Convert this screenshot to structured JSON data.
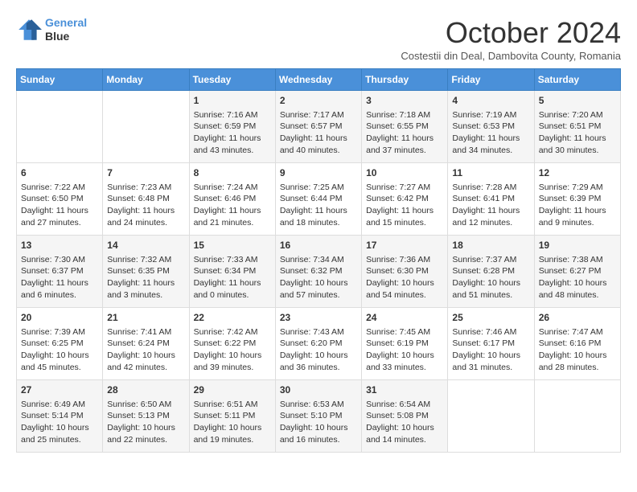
{
  "header": {
    "logo_line1": "General",
    "logo_line2": "Blue",
    "month": "October 2024",
    "location": "Costestii din Deal, Dambovita County, Romania"
  },
  "days_of_week": [
    "Sunday",
    "Monday",
    "Tuesday",
    "Wednesday",
    "Thursday",
    "Friday",
    "Saturday"
  ],
  "weeks": [
    [
      {
        "day": "",
        "content": ""
      },
      {
        "day": "",
        "content": ""
      },
      {
        "day": "1",
        "content": "Sunrise: 7:16 AM\nSunset: 6:59 PM\nDaylight: 11 hours and 43 minutes."
      },
      {
        "day": "2",
        "content": "Sunrise: 7:17 AM\nSunset: 6:57 PM\nDaylight: 11 hours and 40 minutes."
      },
      {
        "day": "3",
        "content": "Sunrise: 7:18 AM\nSunset: 6:55 PM\nDaylight: 11 hours and 37 minutes."
      },
      {
        "day": "4",
        "content": "Sunrise: 7:19 AM\nSunset: 6:53 PM\nDaylight: 11 hours and 34 minutes."
      },
      {
        "day": "5",
        "content": "Sunrise: 7:20 AM\nSunset: 6:51 PM\nDaylight: 11 hours and 30 minutes."
      }
    ],
    [
      {
        "day": "6",
        "content": "Sunrise: 7:22 AM\nSunset: 6:50 PM\nDaylight: 11 hours and 27 minutes."
      },
      {
        "day": "7",
        "content": "Sunrise: 7:23 AM\nSunset: 6:48 PM\nDaylight: 11 hours and 24 minutes."
      },
      {
        "day": "8",
        "content": "Sunrise: 7:24 AM\nSunset: 6:46 PM\nDaylight: 11 hours and 21 minutes."
      },
      {
        "day": "9",
        "content": "Sunrise: 7:25 AM\nSunset: 6:44 PM\nDaylight: 11 hours and 18 minutes."
      },
      {
        "day": "10",
        "content": "Sunrise: 7:27 AM\nSunset: 6:42 PM\nDaylight: 11 hours and 15 minutes."
      },
      {
        "day": "11",
        "content": "Sunrise: 7:28 AM\nSunset: 6:41 PM\nDaylight: 11 hours and 12 minutes."
      },
      {
        "day": "12",
        "content": "Sunrise: 7:29 AM\nSunset: 6:39 PM\nDaylight: 11 hours and 9 minutes."
      }
    ],
    [
      {
        "day": "13",
        "content": "Sunrise: 7:30 AM\nSunset: 6:37 PM\nDaylight: 11 hours and 6 minutes."
      },
      {
        "day": "14",
        "content": "Sunrise: 7:32 AM\nSunset: 6:35 PM\nDaylight: 11 hours and 3 minutes."
      },
      {
        "day": "15",
        "content": "Sunrise: 7:33 AM\nSunset: 6:34 PM\nDaylight: 11 hours and 0 minutes."
      },
      {
        "day": "16",
        "content": "Sunrise: 7:34 AM\nSunset: 6:32 PM\nDaylight: 10 hours and 57 minutes."
      },
      {
        "day": "17",
        "content": "Sunrise: 7:36 AM\nSunset: 6:30 PM\nDaylight: 10 hours and 54 minutes."
      },
      {
        "day": "18",
        "content": "Sunrise: 7:37 AM\nSunset: 6:28 PM\nDaylight: 10 hours and 51 minutes."
      },
      {
        "day": "19",
        "content": "Sunrise: 7:38 AM\nSunset: 6:27 PM\nDaylight: 10 hours and 48 minutes."
      }
    ],
    [
      {
        "day": "20",
        "content": "Sunrise: 7:39 AM\nSunset: 6:25 PM\nDaylight: 10 hours and 45 minutes."
      },
      {
        "day": "21",
        "content": "Sunrise: 7:41 AM\nSunset: 6:24 PM\nDaylight: 10 hours and 42 minutes."
      },
      {
        "day": "22",
        "content": "Sunrise: 7:42 AM\nSunset: 6:22 PM\nDaylight: 10 hours and 39 minutes."
      },
      {
        "day": "23",
        "content": "Sunrise: 7:43 AM\nSunset: 6:20 PM\nDaylight: 10 hours and 36 minutes."
      },
      {
        "day": "24",
        "content": "Sunrise: 7:45 AM\nSunset: 6:19 PM\nDaylight: 10 hours and 33 minutes."
      },
      {
        "day": "25",
        "content": "Sunrise: 7:46 AM\nSunset: 6:17 PM\nDaylight: 10 hours and 31 minutes."
      },
      {
        "day": "26",
        "content": "Sunrise: 7:47 AM\nSunset: 6:16 PM\nDaylight: 10 hours and 28 minutes."
      }
    ],
    [
      {
        "day": "27",
        "content": "Sunrise: 6:49 AM\nSunset: 5:14 PM\nDaylight: 10 hours and 25 minutes."
      },
      {
        "day": "28",
        "content": "Sunrise: 6:50 AM\nSunset: 5:13 PM\nDaylight: 10 hours and 22 minutes."
      },
      {
        "day": "29",
        "content": "Sunrise: 6:51 AM\nSunset: 5:11 PM\nDaylight: 10 hours and 19 minutes."
      },
      {
        "day": "30",
        "content": "Sunrise: 6:53 AM\nSunset: 5:10 PM\nDaylight: 10 hours and 16 minutes."
      },
      {
        "day": "31",
        "content": "Sunrise: 6:54 AM\nSunset: 5:08 PM\nDaylight: 10 hours and 14 minutes."
      },
      {
        "day": "",
        "content": ""
      },
      {
        "day": "",
        "content": ""
      }
    ]
  ]
}
